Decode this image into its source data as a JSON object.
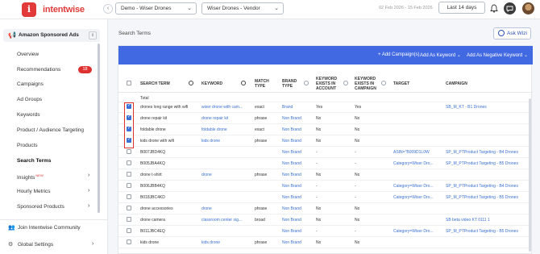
{
  "app": {
    "logo_glyph": "i",
    "logo_text": "intentwise",
    "brand_color": "#e23a3a"
  },
  "header": {
    "collapse_glyph": "‹",
    "account_select": "Demo - Wiser Drones",
    "profile_select": "Wiser Drones - Vendor",
    "date_range": "02 Feb 2026 - 15 Feb 2026",
    "days_button": "Last 14 days",
    "icons": [
      "bell-icon",
      "chat-icon",
      "avatar"
    ]
  },
  "sidebar": {
    "section_icon": "megaphone-icon",
    "section_title": "Amazon Sponsored Ads",
    "items": [
      {
        "label": "Overview"
      },
      {
        "label": "Recommendations",
        "badge": "18"
      },
      {
        "label": "Campaigns"
      },
      {
        "label": "Ad Groups"
      },
      {
        "label": "Keywords"
      },
      {
        "label": "Product / Audience Targeting"
      },
      {
        "label": "Products"
      },
      {
        "label": "Search Terms",
        "active": true
      },
      {
        "label": "Insights",
        "tag": "NEW",
        "chevron": "›"
      },
      {
        "label": "Hourly Metrics",
        "chevron": "›"
      },
      {
        "label": "Sponsored Products",
        "chevron": "›"
      }
    ],
    "footer": [
      {
        "icon": "users-icon",
        "label": "Join Intentwise Community"
      },
      {
        "icon": "gear-icon",
        "label": "Global Settings",
        "chevron": "›"
      }
    ]
  },
  "main": {
    "title": "Search Terms",
    "ask_wizi": "Ask Wizi",
    "actions": {
      "add_campaigns": "+ Add Campaign(s)",
      "add_as_keyword": "Add As Keyword",
      "add_as_negative": "Add As Negative Keyword"
    },
    "columns": {
      "search_term": "SEARCH TERM",
      "keyword": "KEYWORD",
      "match_type": "MATCH TYPE",
      "brand_type": "BRAND TYPE",
      "in_account": "KEYWORD EXISTS IN ACCOUNT",
      "in_campaign": "KEYWORD EXISTS IN CAMPAIGN",
      "target": "TARGET",
      "campaign": "CAMPAIGN"
    },
    "total_label": "Total",
    "rows": [
      {
        "checked": true,
        "term": "drones long range with wifi",
        "keyword": "wiser drone with cam...",
        "match": "exact",
        "brand": "Brand",
        "acct": "Yes",
        "camp": "Yes",
        "target": "",
        "campaign": "SB_M_KT - B1 Drones"
      },
      {
        "checked": true,
        "term": "drone repair kit",
        "keyword": "drone repair kit",
        "match": "phrase",
        "brand": "Non Brand",
        "acct": "No",
        "camp": "No",
        "target": "",
        "campaign": ""
      },
      {
        "checked": true,
        "term": "foldable drone",
        "keyword": "foldable drone",
        "match": "exact",
        "brand": "Non Brand",
        "acct": "No",
        "camp": "No",
        "target": "",
        "campaign": ""
      },
      {
        "checked": true,
        "term": "kids drone with wifi",
        "keyword": "kids drone",
        "match": "phrase",
        "brand": "Non Brand",
        "acct": "No",
        "camp": "No",
        "target": "",
        "campaign": ""
      },
      {
        "checked": false,
        "term": "B007JBD4KQ",
        "keyword": "",
        "match": "",
        "brand": "Non Brand",
        "acct": "-",
        "camp": "-",
        "target": "ASIN=\"B009D1L0W",
        "campaign": "SP_M_PTProduct Targeting - B4 Drones"
      },
      {
        "checked": false,
        "term": "B005JBA4KQ",
        "keyword": "",
        "match": "",
        "brand": "Non Brand",
        "acct": "-",
        "camp": "-",
        "target": "Category=Wiser Dro...",
        "campaign": "SP_M_PTProduct Targeting - B5 Drones"
      },
      {
        "checked": false,
        "term": "drone t-shirt",
        "keyword": "drone",
        "match": "phrase",
        "brand": "Non Brand",
        "acct": "No",
        "camp": "No",
        "target": "",
        "campaign": ""
      },
      {
        "checked": false,
        "term": "B006JBB4KQ",
        "keyword": "",
        "match": "",
        "brand": "Non Brand",
        "acct": "-",
        "camp": "-",
        "target": "Category=Wiser Dro...",
        "campaign": "SP_M_PTProduct Targeting - B4 Drones"
      },
      {
        "checked": false,
        "term": "B018JBC4KD",
        "keyword": "",
        "match": "",
        "brand": "Non Brand",
        "acct": "-",
        "camp": "-",
        "target": "Category=Wiser Dro...",
        "campaign": "SP_M_PTProduct Targeting - B5 Drones"
      },
      {
        "checked": false,
        "term": "drone accessories",
        "keyword": "drone",
        "match": "phrase",
        "brand": "Non Brand",
        "acct": "No",
        "camp": "No",
        "target": "",
        "campaign": ""
      },
      {
        "checked": false,
        "term": "drone camera",
        "keyword": "classroom center sig...",
        "match": "broad",
        "brand": "Non Brand",
        "acct": "No",
        "camp": "No",
        "target": "",
        "campaign": "SB beta video KT 0111 1"
      },
      {
        "checked": false,
        "term": "B011JBC4EQ",
        "keyword": "",
        "match": "",
        "brand": "Non Brand",
        "acct": "-",
        "camp": "-",
        "target": "Category=Wiser Dro...",
        "campaign": "SP_M_PTProduct Targeting - B5 Drones"
      },
      {
        "checked": false,
        "term": "kids drone",
        "keyword": "kids drone",
        "match": "phrase",
        "brand": "Non Brand",
        "acct": "No",
        "camp": "No",
        "target": "",
        "campaign": ""
      }
    ]
  }
}
